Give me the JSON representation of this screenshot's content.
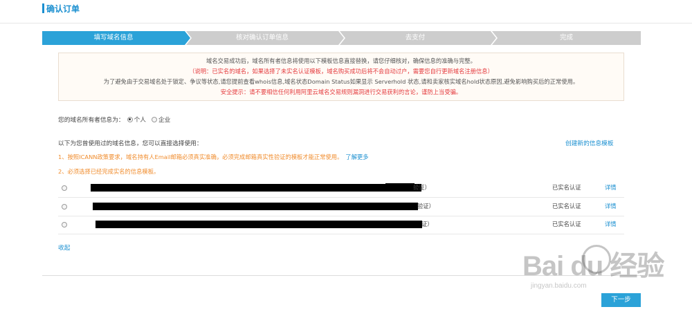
{
  "header": {
    "title": "确认订单"
  },
  "steps": [
    {
      "label": "填写域名信息",
      "active": true
    },
    {
      "label": "核对确认订单信息",
      "active": false
    },
    {
      "label": "去支付",
      "active": false
    },
    {
      "label": "完成",
      "active": false
    }
  ],
  "notice": {
    "line1": "域名交易成功后，域名所有者信息将使用以下模板信息直接替换，请您仔细核对，确保信息的准确与完整。",
    "line2": "（说明：已实名的域名，如果选择了未实名认证模板，域名购买成功后将不会自动过户，需要您自行更新域名注册信息）",
    "line3": "为了避免由于交易域名处于锁定、争议等状态,请您提前查看whois信息,域名状态Domain Status如果显示 Serverhold 状态,请和卖家核实域名hold状态原因,避免影响购买后的正常使用。",
    "line4": "安全提示：请不要相信任何利用阿里云域名交易规则漏洞进行交易获利的言论，谨防上当受骗。"
  },
  "owner": {
    "label": "您的域名所有者信息为：",
    "option_personal": "个人",
    "option_company": "企业",
    "selected": "个人"
  },
  "templates": {
    "heading": "以下为您曾使用过的域名信息，您可以直接选择使用：",
    "create_link": "创建新的信息模板",
    "tip1": "1、按照ICANN政策要求，域名持有人Email邮箱必须真实准确，必须完成邮箱真实性验证的模板才能正常使用。",
    "tip1_link": "了解更多",
    "tip2": "2、必须选择已经完成实名的信息模板。",
    "rows": [
      {
        "tail": "验证）",
        "status": "已实名认证",
        "detail": "详情"
      },
      {
        "tail": "验证）",
        "status": "已实名认证",
        "detail": "详情"
      },
      {
        "tail": "证）",
        "status": "已实名认证",
        "detail": "详情"
      }
    ],
    "collapse": "收起"
  },
  "footer": {
    "next_label": "下一步"
  },
  "watermark": {
    "brand": "Bai  du 经验",
    "url": "jingyan.baidu.com"
  },
  "colors": {
    "accent": "#2ba2d8",
    "inactive_step": "#cdcdcd",
    "warning": "#f08c2d",
    "danger": "#e4393c",
    "link": "#1a8fd0"
  }
}
